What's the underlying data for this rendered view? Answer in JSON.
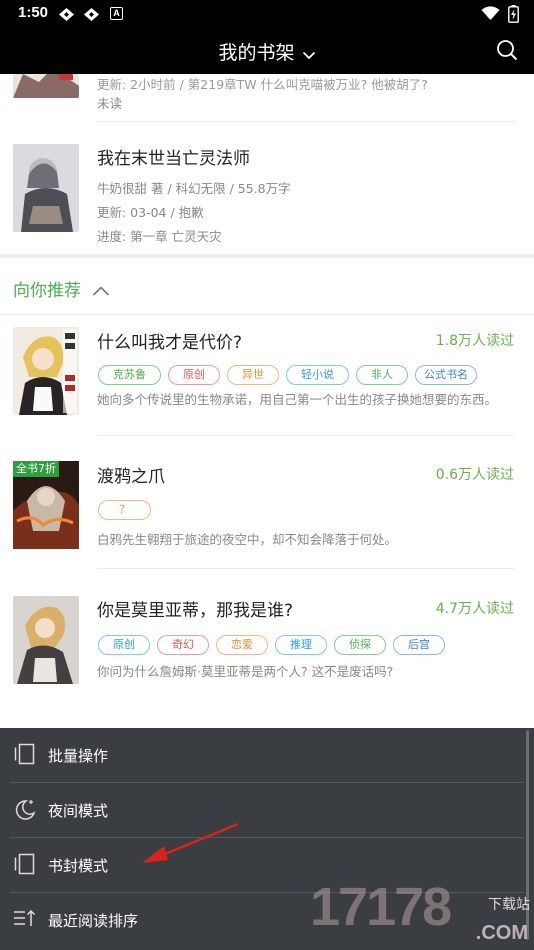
{
  "status": {
    "time": "1:50",
    "badge_letter": "A"
  },
  "header": {
    "title": "我的书架"
  },
  "shelf": {
    "partial": {
      "meta": "更新: 2小时前 / 第219章TW 什么叫克喵被万业? 他被胡了?",
      "progress": "未读"
    },
    "book2": {
      "title": "我在末世当亡灵法师",
      "meta": "牛奶很甜 著 / 科幻无限 / 55.8万字",
      "update": "更新: 03-04 / 抱歉",
      "progress": "进度: 第一章 亡灵天灾"
    }
  },
  "recommend": {
    "heading": "向你推荐",
    "items": [
      {
        "title": "什么叫我才是代价?",
        "reads": "1.8万人读过",
        "tags": [
          "克苏鲁",
          "原创",
          "异世",
          "轻小说",
          "非人",
          "公式书名"
        ],
        "desc": "她向多个传说里的生物承诺，用自己第一个出生的孩子换她想要的东西。"
      },
      {
        "title": "渡鸦之爪",
        "reads": "0.6万人读过",
        "badge": "全书7折",
        "tags": [
          "？"
        ],
        "desc": "白鸦先生翱翔于旅途的夜空中，却不知会降落于何处。"
      },
      {
        "title": "你是莫里亚蒂，那我是谁?",
        "reads": "4.7万人读过",
        "tags": [
          "原创",
          "奇幻",
          "恋爱",
          "推理",
          "侦探",
          "后宫"
        ],
        "desc": "你问为什么詹姆斯·莫里亚蒂是两个人? 这不是废话吗?"
      }
    ]
  },
  "menu": {
    "items": [
      {
        "label": "批量操作",
        "icon": "batch-icon"
      },
      {
        "label": "夜间模式",
        "icon": "night-mode-icon"
      },
      {
        "label": "书封模式",
        "icon": "cover-mode-icon"
      },
      {
        "label": "最近阅读排序",
        "icon": "sort-icon"
      }
    ]
  },
  "watermark": {
    "number": "17178",
    "site": "下载站",
    "domain": ".COM"
  },
  "colors": {
    "accent_green": "#4caf50",
    "sheet_bg": "#3a3d42",
    "arrow": "#d9231d"
  }
}
